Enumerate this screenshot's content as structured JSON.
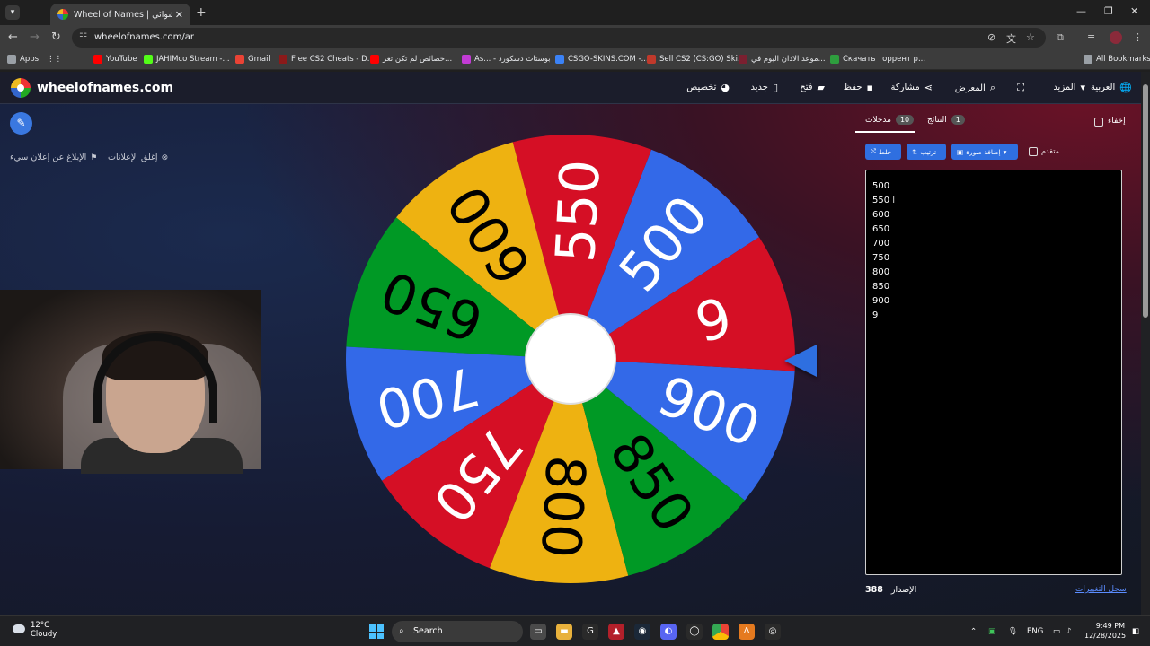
{
  "browser": {
    "tab_title": "Wheel of Names | اسم العشوائي",
    "tab_close": "✕",
    "new_tab": "+",
    "url": "wheelofnames.com/ar",
    "window_controls": [
      "—",
      "❐",
      "✕"
    ],
    "bookmarks": [
      {
        "label": "Apps",
        "color": "#9aa0a6"
      },
      {
        "label": "YouTube",
        "color": "#ff0000"
      },
      {
        "label": "JAHIMco Stream -...",
        "color": "#53fc18"
      },
      {
        "label": "Gmail",
        "color": "#ea4335"
      },
      {
        "label": "Free CS2 Cheats - D...",
        "color": "#8b1a1a"
      },
      {
        "label": "خصائص لم تكن تعر...",
        "color": "#ff0000"
      },
      {
        "label": "As... - بوستات دسكورد",
        "color": "#c23bd4"
      },
      {
        "label": "CSGO-SKINS.COM -...",
        "color": "#3b82f6"
      },
      {
        "label": "Sell CS2 (CS:GO) Ski...",
        "color": "#c0392b"
      },
      {
        "label": "موعد الاذان اليوم في...",
        "color": "#7a2030"
      },
      {
        "label": "Скачать торрент р...",
        "color": "#2e9e3e"
      },
      {
        "label": "All Bookmarks",
        "color": "#9aa0a6"
      }
    ]
  },
  "site": {
    "brand": "wheelofnames.com",
    "nav": [
      {
        "label": "العربية",
        "icon": "globe-icon"
      },
      {
        "label": "المزيد",
        "icon": "chevron-down-icon"
      },
      {
        "label": "",
        "icon": "fullscreen-icon"
      },
      {
        "label": "المعرض",
        "icon": "search-icon"
      },
      {
        "label": "مشاركة",
        "icon": "share-icon"
      },
      {
        "label": "حفظ",
        "icon": "save-icon"
      },
      {
        "label": "فتح",
        "icon": "folder-icon"
      },
      {
        "label": "جديد",
        "icon": "file-icon"
      },
      {
        "label": "تخصيص",
        "icon": "palette-icon"
      }
    ],
    "report_ad": "الإبلاغ عن إعلان سيء",
    "close_ads": "إغلق الإعلانات"
  },
  "wheel": {
    "segments": [
      {
        "label": "500",
        "color": "#3369e8"
      },
      {
        "label": "550",
        "color": "#d50f25"
      },
      {
        "label": "600",
        "color": "#eeb211"
      },
      {
        "label": "650",
        "color": "#009925"
      },
      {
        "label": "700",
        "color": "#3369e8"
      },
      {
        "label": "750",
        "color": "#d50f25"
      },
      {
        "label": "800",
        "color": "#eeb211"
      },
      {
        "label": "850",
        "color": "#009925"
      },
      {
        "label": "900",
        "color": "#3369e8"
      },
      {
        "label": "9",
        "color": "#d50f25"
      }
    ]
  },
  "panel": {
    "tab_entries": "مدخلات",
    "entries_count": "10",
    "tab_results": "النتائج",
    "results_count": "1",
    "hide": "إخفاء",
    "shuffle": "خلط",
    "sort": "ترتيب",
    "add_image": "إضافة صورة",
    "advanced": "متقدم",
    "entries": [
      "500",
      "550",
      "600",
      "650",
      "700",
      "750",
      "800",
      "850",
      "900",
      "9"
    ],
    "version_label": "الإصدار",
    "version_number": "388",
    "changelog": "سجل التغييرات"
  },
  "taskbar": {
    "temp": "12°C",
    "weather": "Cloudy",
    "search": "Search",
    "lang": "ENG",
    "time": "9:49 PM",
    "date": "12/28/2025"
  }
}
